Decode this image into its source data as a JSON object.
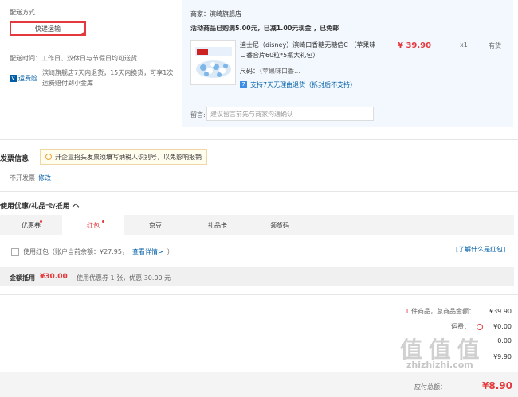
{
  "shipping": {
    "title": "配送方式",
    "method": "快递运输",
    "time": "配送时间：工作日、双休日与节假日均可送货",
    "freight_tag": "运费险",
    "freight_desc": "滨崎旗舰店7天内退货，15天内换货，可享1次运费赔付到小金库"
  },
  "order": {
    "merchant": "商家：滨崎旗舰店",
    "promo": "活动商品已购满5.00元，已减1.00元现金 ，已免邮",
    "product_name": "迪士尼（disney）滨崎口香糖无糖信C （苹果味口香合片60粒*5瓶大礼包）",
    "price": "¥ 39.90",
    "qty": "x1",
    "stock": "有货",
    "size_label": "尺码：",
    "size_value": "（苹果味口香…",
    "returns": "支持7天无理由退货（拆封后不支持）",
    "remark_label": "留言:",
    "remark_placeholder": "建议留言前先与商家沟通确认"
  },
  "invoice": {
    "title": "发票信息",
    "tip": "开企业抬头发票须填写纳税人识别号，以免影响报销",
    "value": "不开发票",
    "edit": "修改"
  },
  "coupons": {
    "title": "使用优惠/礼品卡/抵用",
    "tabs": [
      {
        "label": "优惠券",
        "dot": true
      },
      {
        "label": "红包",
        "dot": true
      },
      {
        "label": "京豆",
        "dot": false
      },
      {
        "label": "礼品卡",
        "dot": false
      },
      {
        "label": "领货码",
        "dot": false
      }
    ],
    "active_tab": 1,
    "redpacket_text": "使用红包（账户当前余额：¥27.95，",
    "redpacket_link": "查看详情>",
    "redpacket_close": "）",
    "learn_more": "[了解什么是红包]",
    "discount_label": "金额抵用",
    "discount_amount": "¥30.00",
    "discount_note": "使用优惠券 1 张，优惠 30.00 元"
  },
  "summary": {
    "count_prefix": "1",
    "count_label": "件商品，总商品金额：",
    "goods_total": "¥39.90",
    "freight_label": "运费：",
    "freight_value": "¥0.00",
    "row3_value": "0.00",
    "row4_value": "¥9.90",
    "pay_label": "应付总额：",
    "pay_amount": "¥8.90"
  },
  "watermark": {
    "text": "值 值 值",
    "url": "zhizhizhi.com"
  }
}
